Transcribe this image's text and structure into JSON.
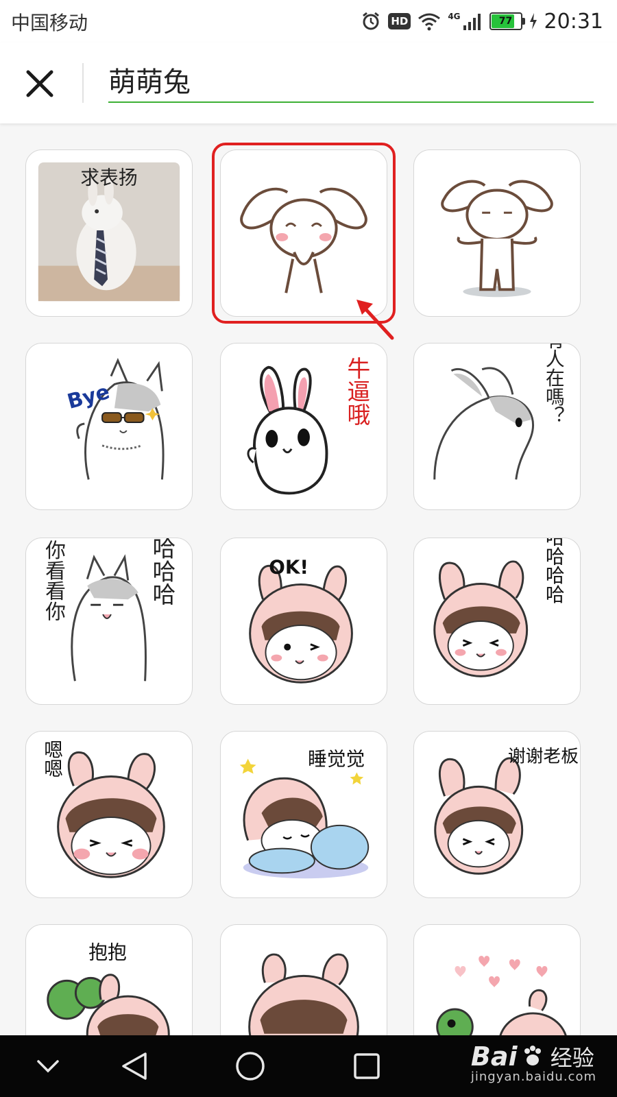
{
  "status_bar": {
    "carrier": "中国移动",
    "hd_badge": "HD",
    "network": "4G",
    "battery_level": "77",
    "time": "20:31"
  },
  "search": {
    "query": "萌萌兔",
    "close_icon": "close-icon"
  },
  "stickers": [
    {
      "id": 1,
      "caption": "求表扬"
    },
    {
      "id": 2,
      "caption": ""
    },
    {
      "id": 3,
      "caption": ""
    },
    {
      "id": 4,
      "caption": "Bye"
    },
    {
      "id": 5,
      "caption": "牛逼哦"
    },
    {
      "id": 6,
      "caption": "有人在嗎？"
    },
    {
      "id": 7,
      "caption_left": "你看看你",
      "caption_right": "哈哈哈"
    },
    {
      "id": 8,
      "caption": "OK!"
    },
    {
      "id": 9,
      "caption": "哈哈哈哈"
    },
    {
      "id": 10,
      "caption": "嗯嗯"
    },
    {
      "id": 11,
      "caption": "睡觉觉"
    },
    {
      "id": 12,
      "caption": "谢谢老板"
    },
    {
      "id": 13,
      "caption": "抱抱"
    },
    {
      "id": 14,
      "caption": ""
    },
    {
      "id": 15,
      "caption": ""
    }
  ],
  "selected_sticker": 2,
  "colors": {
    "accent_underline": "#3cb034",
    "highlight": "#e02020",
    "navbar": "#060606"
  },
  "navigation": {
    "back_icon": "back-triangle-icon",
    "home_icon": "home-circle-icon",
    "recents_icon": "recents-square-icon",
    "collapse_icon": "chevron-down-icon"
  },
  "watermark": {
    "brand": "Bai",
    "brand_cn": "经验",
    "url": "jingyan.baidu.com"
  }
}
